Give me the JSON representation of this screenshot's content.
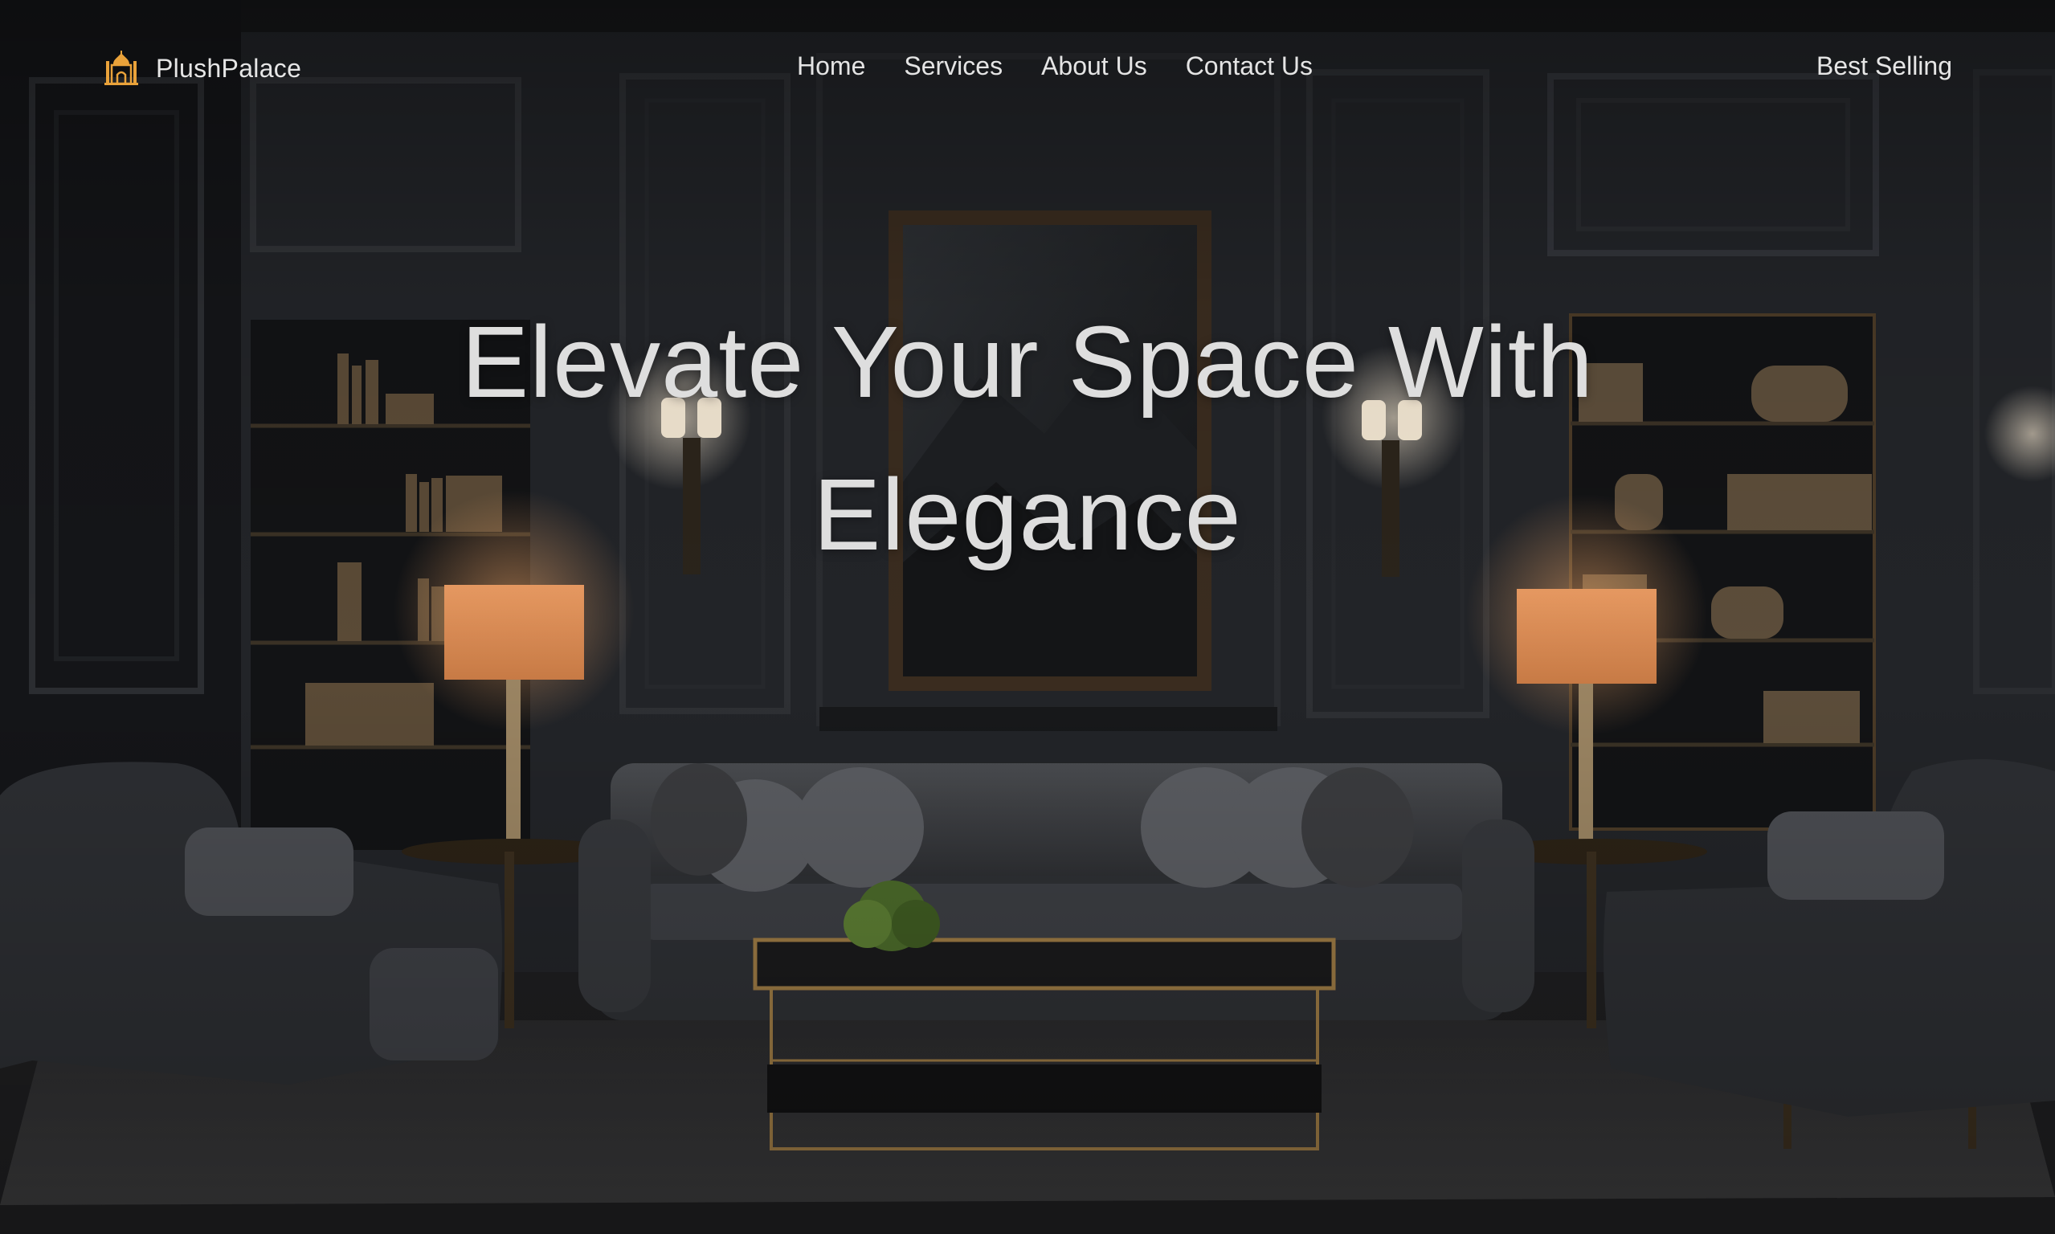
{
  "brand": {
    "name": "PlushPalace",
    "icon": "palace-icon",
    "icon_color": "#e9a23a"
  },
  "nav": {
    "items": [
      {
        "label": "Home"
      },
      {
        "label": "Services"
      },
      {
        "label": "About Us"
      },
      {
        "label": "Contact Us"
      }
    ],
    "cta_label": "Best Selling"
  },
  "hero": {
    "headline": "Elevate Your Space With Elegance",
    "image": "dark-paneled-living-room-photo"
  },
  "colors": {
    "text": "#e4e4e4",
    "headline": "#dedede",
    "background": "#1c1d20",
    "accent": "#e9a23a"
  }
}
